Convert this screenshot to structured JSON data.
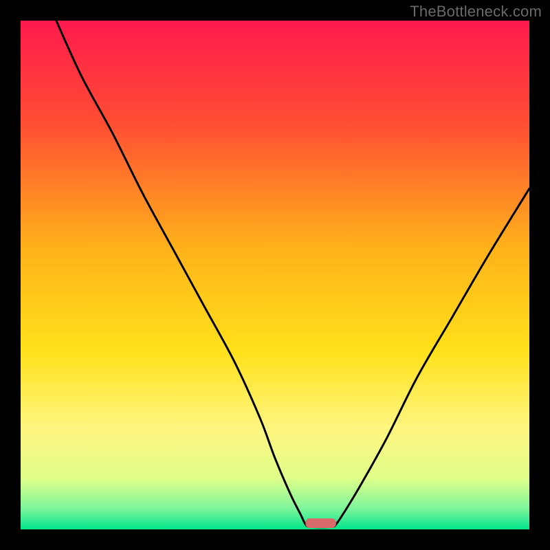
{
  "watermark": "TheBottleneck.com",
  "chart_data": {
    "type": "line",
    "title": "",
    "xlabel": "",
    "ylabel": "",
    "xlim": [
      0,
      100
    ],
    "ylim": [
      0,
      100
    ],
    "grid": false,
    "legend": false,
    "background_gradient": [
      {
        "pos": 0.0,
        "color": "#ff1a4d"
      },
      {
        "pos": 0.2,
        "color": "#ff4d33"
      },
      {
        "pos": 0.45,
        "color": "#ffb31a"
      },
      {
        "pos": 0.65,
        "color": "#ffe11a"
      },
      {
        "pos": 0.8,
        "color": "#fff680"
      },
      {
        "pos": 0.9,
        "color": "#dfff8a"
      },
      {
        "pos": 0.96,
        "color": "#7cf59c"
      },
      {
        "pos": 1.0,
        "color": "#00e58b"
      }
    ],
    "series": [
      {
        "name": "bottleneck-curve",
        "x": [
          7,
          12,
          18,
          24,
          30,
          36,
          42,
          47,
          50,
          53,
          55,
          56,
          57,
          61,
          62,
          64,
          67,
          72,
          78,
          85,
          92,
          100
        ],
        "values": [
          100,
          89,
          78,
          66,
          55,
          44,
          33,
          22,
          14,
          7,
          3,
          1,
          0.5,
          0.5,
          1,
          4,
          9,
          18,
          30,
          42,
          54,
          67
        ]
      }
    ],
    "marker": {
      "name": "optimal-range",
      "x_center": 59,
      "width": 6,
      "color": "#d86a6a"
    }
  }
}
